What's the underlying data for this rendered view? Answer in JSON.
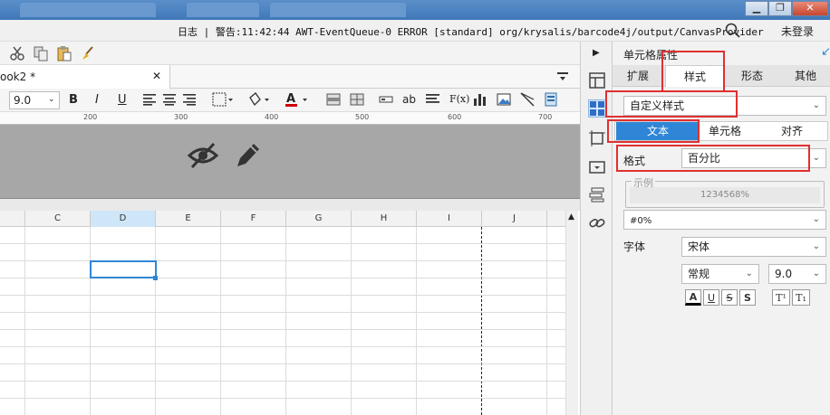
{
  "titlebar": {
    "controls": {
      "minimize": "▁",
      "restore": "❐",
      "close": "✕"
    }
  },
  "status": {
    "log_label": "日志",
    "log_message": "| 警告:11:42:44 AWT-EventQueue-0 ERROR [standard] org/krysalis/barcode4j/output/CanvasProvider",
    "login": "未登录"
  },
  "editor": {
    "tab_label": "ook2 *",
    "tab_close": "✕",
    "font_size": "9.0",
    "format_buttons": {
      "bold": "B",
      "italic": "I",
      "underline": "U",
      "text": "ab",
      "fx": "F(x)"
    },
    "ruler_ticks": [
      "200",
      "300",
      "400",
      "500",
      "600",
      "700"
    ],
    "columns": [
      "C",
      "D",
      "E",
      "F",
      "G",
      "H",
      "I",
      "J"
    ]
  },
  "panel": {
    "title": "单元格属性",
    "tabs": [
      "扩展",
      "样式",
      "形态",
      "其他"
    ],
    "active_tab": "样式",
    "style_select": "自定义样式",
    "subtabs": [
      "文本",
      "单元格",
      "对齐"
    ],
    "active_subtab": "文本",
    "format_label": "格式",
    "format_value": "百分比",
    "example_label": "示例",
    "example_value": "1234568%",
    "pattern_value": "#0%",
    "font_label": "字体",
    "font_value": "宋体",
    "font_style": "常规",
    "font_size": "9.0",
    "text_buttons": {
      "color": "A",
      "underline": "U",
      "strike": "S",
      "shadow": "S",
      "superscript": "T¹",
      "subscript": "T₁"
    }
  },
  "colors": {
    "accent": "#2f86d6",
    "highlight": "#e03030",
    "selected_col": "#cfe6f8"
  }
}
